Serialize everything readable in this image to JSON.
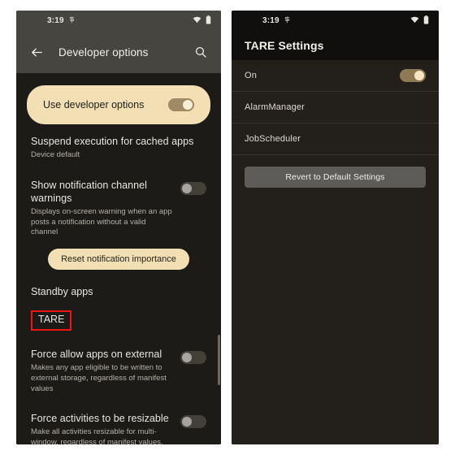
{
  "meta": {
    "accent_cream": "#f2dfb3",
    "highlight_box_color": "#f01414",
    "dark_bg": "#1d1b18",
    "right_bg": "#231f1a"
  },
  "left_phone": {
    "status_bar": {
      "time": "3:19",
      "notify_icon": "notification-glyph-icon",
      "wifi_icon": "wifi-icon",
      "battery_icon": "battery-icon"
    },
    "app_bar": {
      "back_icon": "arrow-back-icon",
      "title": "Developer options",
      "search_icon": "search-icon"
    },
    "master_switch": {
      "label": "Use developer options",
      "state": "on"
    },
    "items": [
      {
        "title": "Suspend execution for cached apps",
        "subtitle": "Device default",
        "control": "none"
      },
      {
        "title": "Show notification channel warnings",
        "subtitle": "Displays on-screen warning when an app posts a notification without a valid channel",
        "control": "toggle-off"
      }
    ],
    "reset_chip": "Reset notification importance",
    "standby_apps": "Standby apps",
    "tare_item": "TARE",
    "items2": [
      {
        "title": "Force allow apps on external",
        "subtitle": "Makes any app eligible to be written to external storage, regardless of manifest values",
        "control": "toggle-off"
      },
      {
        "title": "Force activities to be resizable",
        "subtitle": "Make all activities resizable for multi-window, regardless of manifest values.",
        "control": "toggle-off"
      }
    ]
  },
  "right_phone": {
    "status_bar": {
      "time": "3:19",
      "notify_icon": "notification-glyph-icon",
      "wifi_icon": "wifi-icon",
      "battery_icon": "battery-icon"
    },
    "app_bar": {
      "title": "TARE Settings"
    },
    "rows": [
      {
        "label": "On",
        "control": "toggle-on"
      },
      {
        "label": "AlarmManager",
        "control": "none"
      },
      {
        "label": "JobScheduler",
        "control": "none"
      }
    ],
    "revert_button": "Revert to Default Settings"
  }
}
